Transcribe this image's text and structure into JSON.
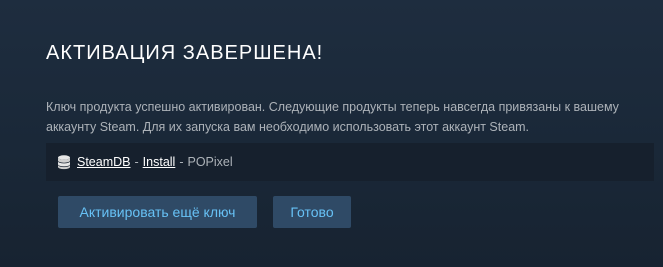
{
  "dialog": {
    "title": "АКТИВАЦИЯ ЗАВЕРШЕНА!",
    "message_line1": "Ключ продукта успешно активирован. Следующие продукты теперь навсегда привязаны к вашему",
    "message_line2": "аккаунту Steam. Для их запуска вам необходимо использовать этот аккаунт Steam."
  },
  "product": {
    "icon": "database-icon",
    "link1": "SteamDB",
    "link2": "Install",
    "separator": "-",
    "name": "POPixel"
  },
  "buttons": {
    "activate_another": "Активировать ещё ключ",
    "done": "Готово"
  },
  "colors": {
    "background": "#1b2838",
    "button_bg": "#2f4a66",
    "button_text": "#67c1f5",
    "product_row_bg": "#16202d"
  }
}
